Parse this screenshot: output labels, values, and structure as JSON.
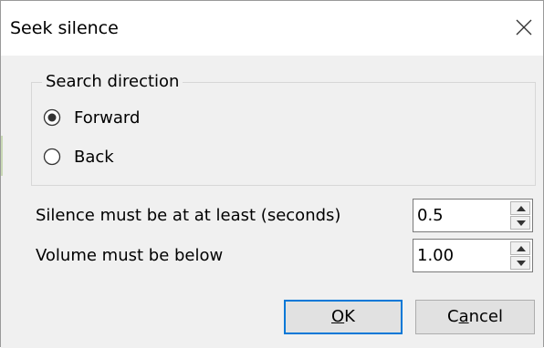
{
  "window": {
    "title": "Seek silence"
  },
  "direction_group": {
    "legend": "Search direction",
    "options": [
      {
        "label": "Forward",
        "selected": true
      },
      {
        "label": "Back",
        "selected": false
      }
    ]
  },
  "silence_length": {
    "label": "Silence must be at at least (seconds)",
    "value": "0.5"
  },
  "volume": {
    "label": "Volume must be below",
    "value": "1.00"
  },
  "buttons": {
    "ok": {
      "label": "OK",
      "accel": "O",
      "rest": "K"
    },
    "cancel": {
      "label": "Cancel",
      "pre": "C",
      "accel": "a",
      "rest": "ncel"
    }
  },
  "icons": {
    "close": "close-icon",
    "spin_up": "chevron-up-icon",
    "spin_down": "chevron-down-icon",
    "radio_selected": "radio-selected-icon",
    "radio_unselected": "radio-unselected-icon"
  },
  "colors": {
    "dialog_background": "#f0f0f0",
    "titlebar_background": "#ffffff",
    "default_button_border": "#0078d7",
    "button_face": "#e1e1e1"
  }
}
